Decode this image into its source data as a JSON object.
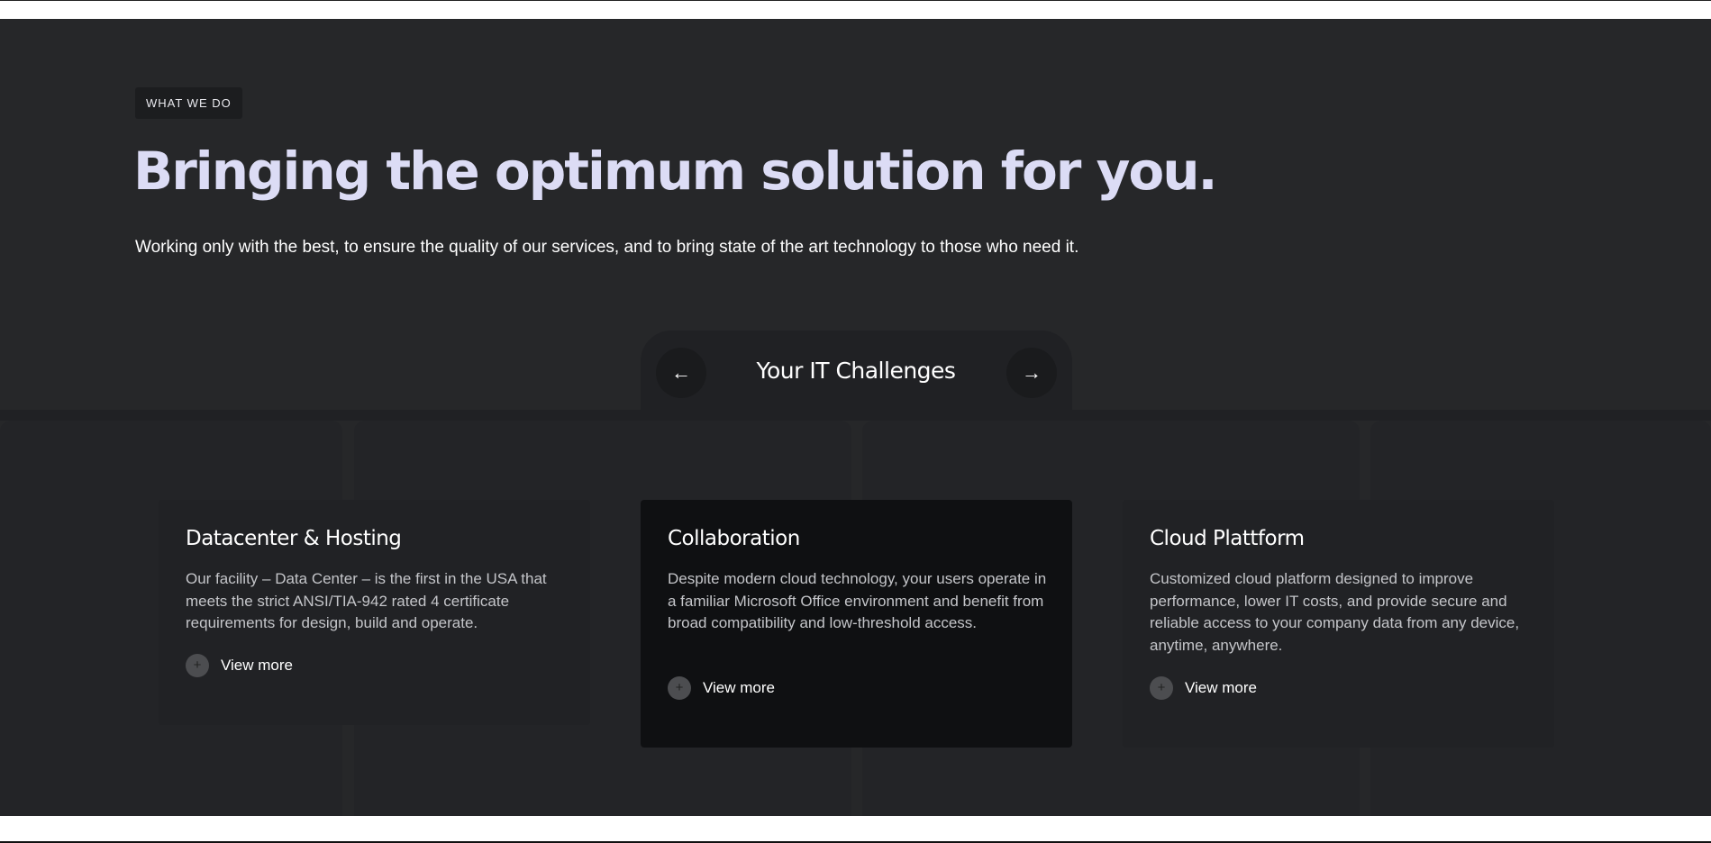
{
  "section": {
    "eyebrow": "WHAT WE DO",
    "headline": "Bringing the optimum solution for you.",
    "subtext": "Working only with the best, to ensure the quality of our services, and to bring state of the art technology to those who need it."
  },
  "carousel": {
    "title": "Your IT Challenges",
    "prev_icon": "←",
    "next_icon": "→",
    "cards": [
      {
        "title": "Datacenter & Hosting",
        "description": "Our facility – Data Center – is the first in the USA that meets the strict ANSI/TIA-942 rated 4 certificate requirements for design, build and operate.",
        "link_label": "View more",
        "icon": "+"
      },
      {
        "title": "Collaboration",
        "description": "Despite modern cloud technology, your users operate in a familiar Microsoft Office environment and benefit from broad compatibility and low-threshold access.",
        "link_label": "View more",
        "icon": "+"
      },
      {
        "title": "Cloud Plattform",
        "description": "Customized cloud platform designed to improve performance, lower IT costs, and provide secure and reliable access to your company data from any device, anytime, anywhere.",
        "link_label": "View more",
        "icon": "+"
      }
    ]
  },
  "colors": {
    "section_bg": "#262729",
    "headline": "#dcdcf5",
    "active_card_bg": "#0f1012",
    "card_bg": "#212225"
  }
}
